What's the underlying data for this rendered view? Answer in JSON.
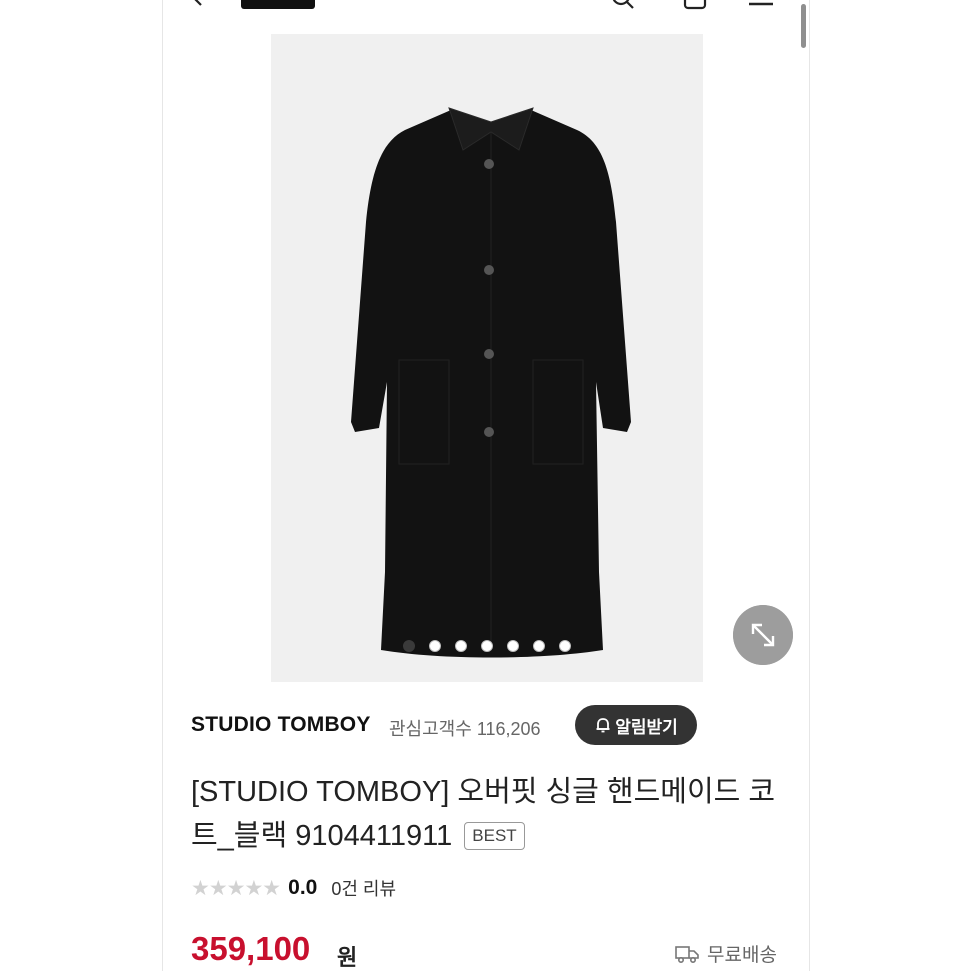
{
  "header": {
    "back_icon": "chevron-left-icon",
    "search_icon": "search-icon",
    "bag_icon": "shopping-bag-icon",
    "menu_icon": "hamburger-menu-icon"
  },
  "gallery": {
    "slide_count": 7,
    "active_index": 0,
    "expand_icon": "expand-arrows-icon"
  },
  "brand": {
    "name": "STUDIO TOMBOY",
    "followers_label": "관심고객수",
    "followers_count": "116,206",
    "alarm_button": "알림받기"
  },
  "product": {
    "title": "[STUDIO TOMBOY] 오버핏 싱글 핸드메이드 코트_블랙 9104411911",
    "badge": "BEST"
  },
  "rating": {
    "stars_filled": 0,
    "stars_total": 5,
    "stars": "★★★★★",
    "score": "0.0",
    "review_text": "0건 리뷰"
  },
  "price": {
    "amount": "359,100",
    "currency": "원",
    "color": "#c8102e"
  },
  "shipping": {
    "label": "무료배송"
  }
}
